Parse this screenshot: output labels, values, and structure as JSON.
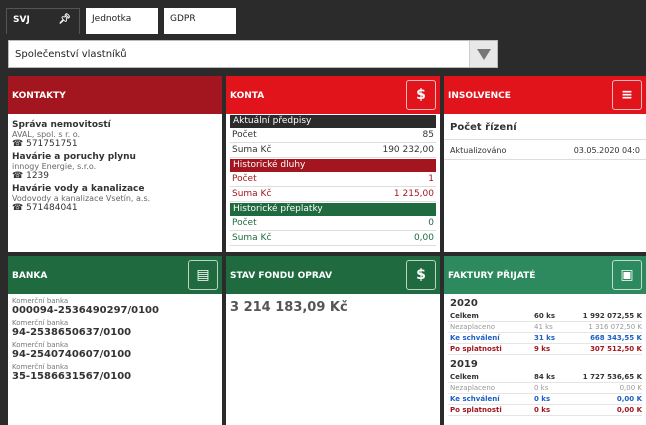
{
  "tabs": [
    {
      "label": "SVJ"
    },
    {
      "label": "Jednotka"
    },
    {
      "label": "GDPR"
    }
  ],
  "select": {
    "value": "Společenství vlastníků"
  },
  "kontakty": {
    "title": "KONTAKTY",
    "items": [
      {
        "name": "Správa nemovitostí",
        "firm": "AVAL, spol. s r. o.",
        "tel": "571751751"
      },
      {
        "name": "Havárie a poruchy plynu",
        "firm": "innogy Energie, s.r.o.",
        "tel": "1239"
      },
      {
        "name": "Havárie vody a kanalizace",
        "firm": "Vodovody a kanalizace Vsetín, a.s.",
        "tel": "571484041"
      }
    ]
  },
  "konta": {
    "title": "KONTA",
    "sections": [
      {
        "header": "Aktuální předpisy",
        "style": "dark",
        "rows": [
          {
            "label": "Počet",
            "value": "85"
          },
          {
            "label": "Suma Kč",
            "value": "190 232,00"
          }
        ]
      },
      {
        "header": "Historické dluhy",
        "style": "red",
        "rows": [
          {
            "label": "Počet",
            "value": "1"
          },
          {
            "label": "Suma Kč",
            "value": "1 215,00"
          }
        ]
      },
      {
        "header": "Historické přeplatky",
        "style": "green",
        "rows": [
          {
            "label": "Počet",
            "value": "0"
          },
          {
            "label": "Suma Kč",
            "value": "0,00"
          }
        ]
      }
    ]
  },
  "insolvence": {
    "title": "INSOLVENCE",
    "heading": "Počet řízení",
    "updated_label": "Aktualizováno",
    "updated_value": "03.05.2020 04:0"
  },
  "banka": {
    "title": "BANKA",
    "accounts": [
      {
        "type": "Komerční banka",
        "number": "000094-2536490297/0100"
      },
      {
        "type": "Komerční banka",
        "number": "94-2538650637/0100"
      },
      {
        "type": "Komerční banka",
        "number": "94-2540740607/0100"
      },
      {
        "type": "Komerční banka",
        "number": "35-1586631567/0100"
      }
    ]
  },
  "fond": {
    "title": "STAV FONDU OPRAV",
    "amount": "3 214 183,09 Kč"
  },
  "faktury": {
    "title": "FAKTURY PŘIJATÉ",
    "years": [
      {
        "year": "2020",
        "rows": [
          {
            "label": "Celkem",
            "ks": "60 ks",
            "amount": "1 992 072,55 K",
            "style": "bold"
          },
          {
            "label": "Nezaplaceno",
            "ks": "41 ks",
            "amount": "1 316 072,50 K",
            "style": "grey"
          },
          {
            "label": "Ke schválení",
            "ks": "31 ks",
            "amount": "668 343,55 K",
            "style": "blue"
          },
          {
            "label": "Po splatnosti",
            "ks": "9 ks",
            "amount": "307 512,50 K",
            "style": "red"
          }
        ]
      },
      {
        "year": "2019",
        "rows": [
          {
            "label": "Celkem",
            "ks": "84 ks",
            "amount": "1 727 536,65 K",
            "style": "bold"
          },
          {
            "label": "Nezaplaceno",
            "ks": "0 ks",
            "amount": "0,00 K",
            "style": "grey"
          },
          {
            "label": "Ke schválení",
            "ks": "0 ks",
            "amount": "0,00 K",
            "style": "blue"
          },
          {
            "label": "Po splatnosti",
            "ks": "0 ks",
            "amount": "0,00 K",
            "style": "red"
          }
        ]
      }
    ]
  }
}
